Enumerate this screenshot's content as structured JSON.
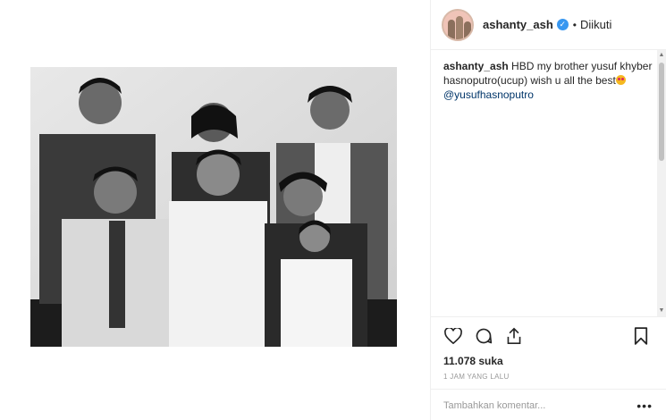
{
  "header": {
    "username": "ashanty_ash",
    "follow_status": "Diikuti",
    "separator": "•"
  },
  "caption": {
    "username": "ashanty_ash",
    "text": "HBD my brother yusuf khyber hasnoputro(ucup) wish u all the best",
    "mention": "@yusufhasnoputro"
  },
  "actions": {
    "likes": "11.078 suka",
    "timestamp": "1 JAM YANG LALU",
    "icons": [
      "heart-icon",
      "comment-icon",
      "share-icon",
      "bookmark-icon"
    ]
  },
  "comment": {
    "placeholder": "Tambahkan komentar...",
    "more": "•••"
  },
  "colors": {
    "verified": "#3897f0",
    "mention": "#003569",
    "border": "#efefef"
  }
}
